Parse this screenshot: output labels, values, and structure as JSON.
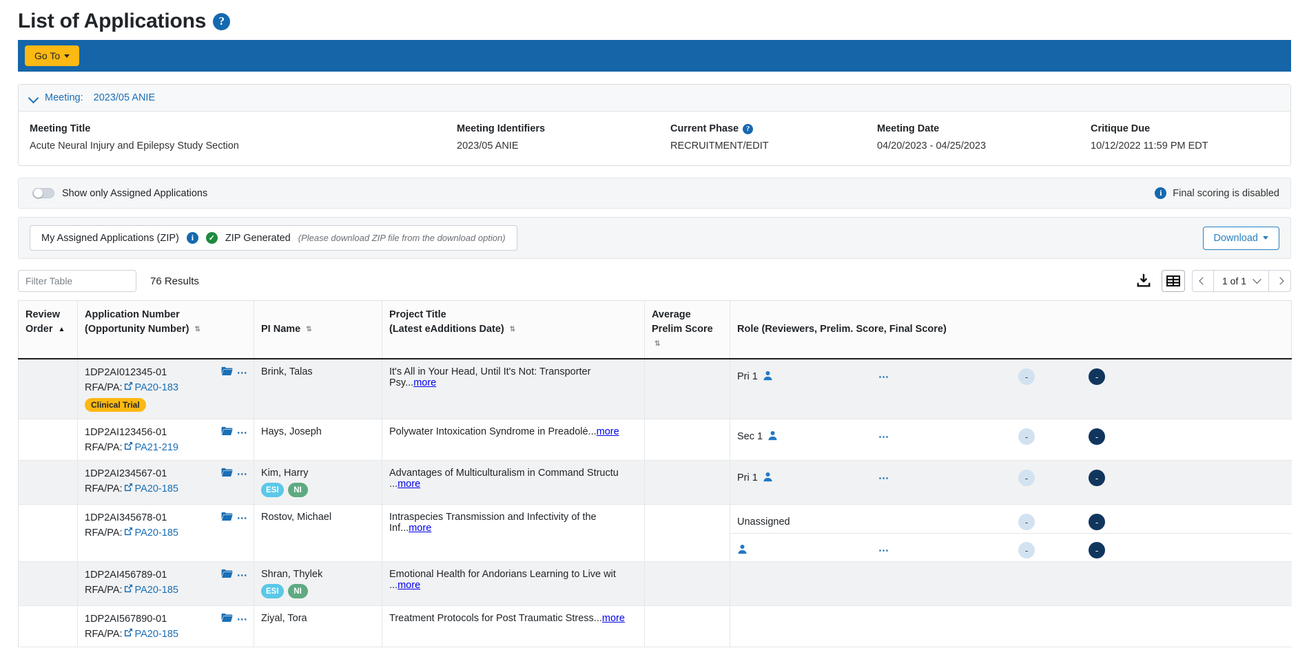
{
  "header": {
    "title": "List of Applications",
    "help_icon": "question-mark-circle-icon",
    "goto_label": "Go To"
  },
  "meeting": {
    "collapse_label": "Meeting:",
    "collapse_value": "2023/05 ANIE",
    "fields": [
      {
        "label": "Meeting Title",
        "value": "Acute Neural Injury and Epilepsy Study Section",
        "has_help": false
      },
      {
        "label": "Meeting Identifiers",
        "value": "2023/05 ANIE",
        "has_help": false
      },
      {
        "label": "Current Phase",
        "value": "RECRUITMENT/EDIT",
        "has_help": true
      },
      {
        "label": "Meeting Date",
        "value": "04/20/2023 - 04/25/2023",
        "has_help": false
      },
      {
        "label": "Critique Due",
        "value": "10/12/2022 11:59 PM EDT",
        "has_help": false
      }
    ]
  },
  "options": {
    "toggle_label": "Show only Assigned Applications",
    "toggle_state": "off",
    "scoring_note": "Final scoring is disabled"
  },
  "zip": {
    "title": "My Assigned Applications (ZIP)",
    "status": "ZIP Generated",
    "hint": "(Please download ZIP file from the download option)",
    "download_label": "Download"
  },
  "toolbar": {
    "filter_placeholder": "Filter Table",
    "filter_value": "",
    "results": "76 Results",
    "page_value": "1 of 1",
    "export_icon": "download-icon",
    "columns_icon": "table-columns-icon"
  },
  "table": {
    "columns": [
      {
        "line1": "Review",
        "line2": "Order",
        "sort": "asc"
      },
      {
        "line1": "Application Number",
        "line2": "(Opportunity Number)",
        "sort": "both"
      },
      {
        "line1": "",
        "line2": "PI Name",
        "sort": "both"
      },
      {
        "line1": "Project Title",
        "line2": "(Latest eAdditions Date)",
        "sort": "both"
      },
      {
        "line1": "Average",
        "line2": "Prelim Score",
        "sort": "both"
      },
      {
        "line1": "",
        "line2": "Role (Reviewers, Prelim. Score, Final Score)",
        "sort": "none"
      }
    ],
    "rows": [
      {
        "review_order": "",
        "app_number": "1DP2AI012345-01",
        "rfa_label": "RFA/PA:",
        "rfa_link": "PA20-183",
        "badge": "Clinical Trial",
        "pi_name": "Brink, Talas",
        "chips": [],
        "project_title": "It's All in Your Head, Until It's Not: Transporter Psy...",
        "more_label": "more",
        "avg_prelim": "",
        "roles": [
          {
            "name": "Pri 1",
            "has_person": true,
            "has_dots": true,
            "prelim": "-",
            "final": "-"
          }
        ]
      },
      {
        "review_order": "",
        "app_number": "1DP2AI123456-01",
        "rfa_label": "RFA/PA:",
        "rfa_link": "PA21-219",
        "badge": "",
        "pi_name": "Hays, Joseph",
        "chips": [],
        "project_title": "Polywater Intoxication Syndrome in Preadolė...",
        "more_label": "more",
        "avg_prelim": "",
        "roles": [
          {
            "name": "Sec 1",
            "has_person": true,
            "has_dots": true,
            "prelim": "-",
            "final": "-"
          }
        ]
      },
      {
        "review_order": "",
        "app_number": "1DP2AI234567-01",
        "rfa_label": "RFA/PA:",
        "rfa_link": "PA20-185",
        "badge": "",
        "pi_name": "Kim, Harry",
        "chips": [
          "ESI",
          "NI"
        ],
        "project_title": "Advantages of Multiculturalism in Command Structu ...",
        "more_label": "more",
        "avg_prelim": "",
        "roles": [
          {
            "name": "Pri 1",
            "has_person": true,
            "has_dots": true,
            "prelim": "-",
            "final": "-"
          }
        ]
      },
      {
        "review_order": "",
        "app_number": "1DP2AI345678-01",
        "rfa_label": "RFA/PA:",
        "rfa_link": "PA20-185",
        "badge": "",
        "pi_name": "Rostov, Michael",
        "chips": [],
        "project_title": "Intraspecies Transmission and Infectivity of the Inf...",
        "more_label": "more",
        "avg_prelim": "",
        "roles": [
          {
            "name": "Unassigned",
            "has_person": false,
            "has_dots": false,
            "prelim": "-",
            "final": "-"
          },
          {
            "name": "",
            "has_person": true,
            "has_dots": true,
            "prelim": "-",
            "final": "-"
          }
        ]
      },
      {
        "review_order": "",
        "app_number": "1DP2AI456789-01",
        "rfa_label": "RFA/PA:",
        "rfa_link": "PA20-185",
        "badge": "",
        "pi_name": "Shran, Thylek",
        "chips": [
          "ESI",
          "NI"
        ],
        "project_title": "Emotional Health for Andorians Learning to Live wit ...",
        "more_label": "more",
        "avg_prelim": "",
        "roles": []
      },
      {
        "review_order": "",
        "app_number": "1DP2AI567890-01",
        "rfa_label": "RFA/PA:",
        "rfa_link": "PA20-185",
        "badge": "",
        "pi_name": "Ziyal, Tora",
        "chips": [],
        "project_title": "Treatment Protocols for Post Traumatic Stress...",
        "more_label": "more",
        "avg_prelim": "",
        "roles": []
      }
    ]
  },
  "colors": {
    "action_bar": "#1565a8",
    "accent_yellow": "#fcb813",
    "link_blue": "#1a6fb5",
    "chip_esi": "#5bc8e8",
    "chip_ni": "#5eaa82",
    "pill_dark": "#11365e",
    "pill_light": "#d3e2f0",
    "status_green": "#1e8a3c"
  }
}
